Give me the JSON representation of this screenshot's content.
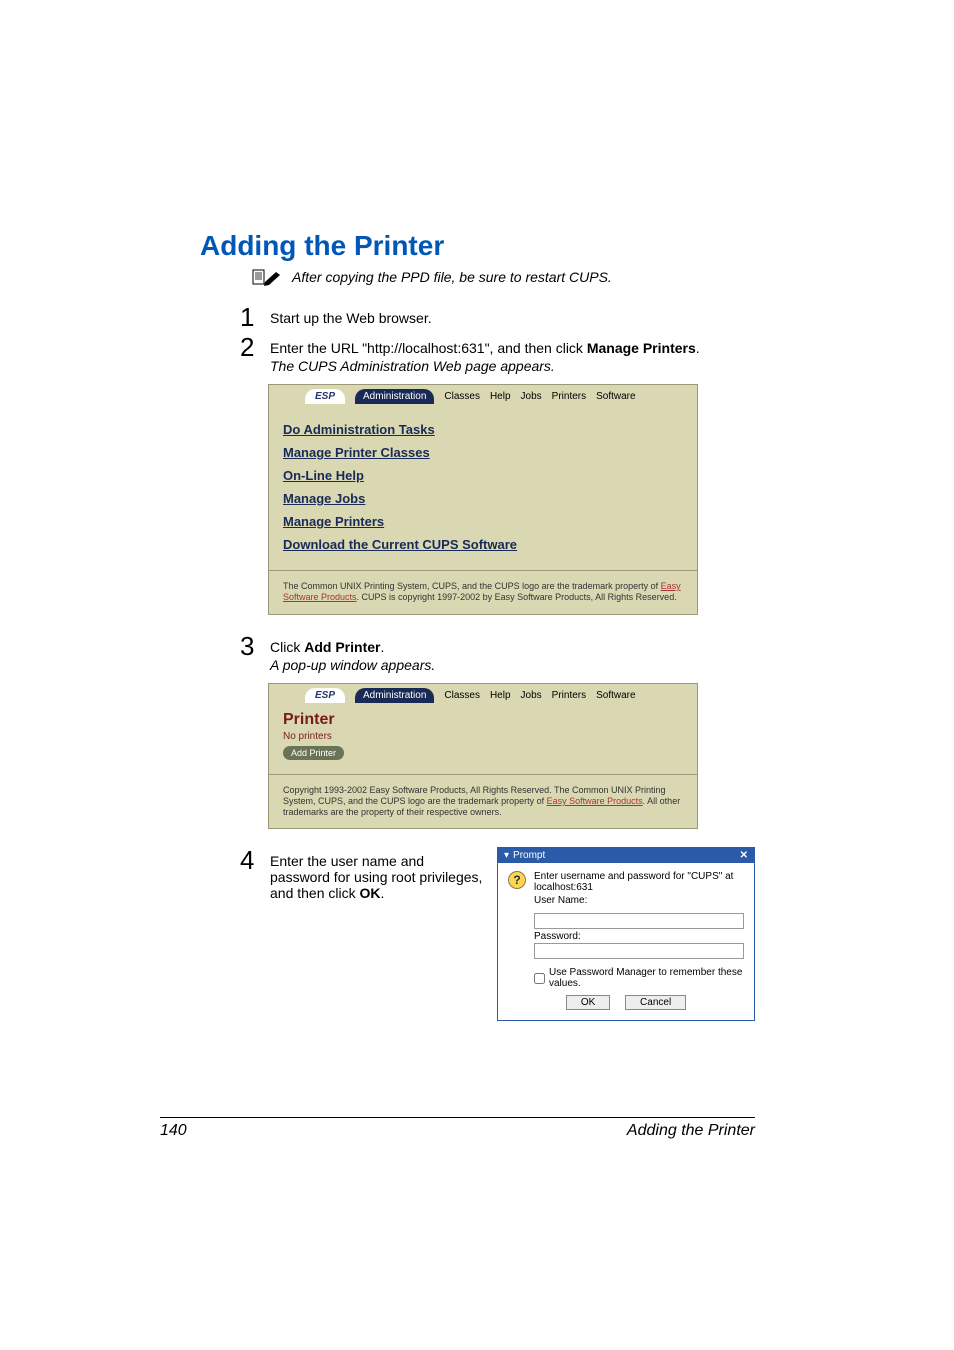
{
  "heading": "Adding the Printer",
  "note": {
    "text": "After copying the PPD file, be sure to restart CUPS."
  },
  "steps": {
    "s1": {
      "num": "1",
      "text": "Start up the Web browser."
    },
    "s2": {
      "num": "2",
      "text_a": "Enter the URL \"http://localhost:631\", and then click ",
      "text_bold": "Manage Printers",
      "text_b": ".",
      "sub": "The CUPS Administration Web page appears."
    },
    "s3": {
      "num": "3",
      "text_a": "Click ",
      "text_bold": "Add Printer",
      "text_b": ".",
      "sub": "A pop-up window appears."
    },
    "s4": {
      "num": "4",
      "text_a": "Enter the user name and password for using root privileges, and then click ",
      "text_bold": "OK",
      "text_b": "."
    }
  },
  "cups_tabs": {
    "esp": "ESP",
    "admin": "Administration",
    "classes": "Classes",
    "help": "Help",
    "jobs": "Jobs",
    "printers": "Printers",
    "software": "Software"
  },
  "cups1": {
    "links": {
      "l1": "Do Administration Tasks",
      "l2": "Manage Printer Classes",
      "l3": "On-Line Help",
      "l4": "Manage Jobs",
      "l5": "Manage Printers",
      "l6": "Download the Current CUPS Software"
    },
    "footnote_a": "The Common UNIX Printing System, CUPS, and the CUPS logo are the trademark property of ",
    "footnote_link": "Easy Software Products",
    "footnote_b": ". CUPS is copyright 1997-2002 by Easy Software Products, All Rights Reserved."
  },
  "cups2": {
    "printer": "Printer",
    "no_printers": "No printers",
    "add_printer": "Add Printer",
    "footnote_a": "Copyright 1993-2002 Easy Software Products, All Rights Reserved. The Common UNIX Printing System, CUPS, and the CUPS logo are the trademark property of ",
    "footnote_link": "Easy Software Products",
    "footnote_b": ". All other trademarks are the property of their respective owners."
  },
  "prompt": {
    "title": "Prompt",
    "close": "✕",
    "msg": "Enter username and password for \"CUPS\" at localhost:631",
    "user_label": "User Name:",
    "pass_label": "Password:",
    "remember": "Use Password Manager to remember these values.",
    "ok": "OK",
    "cancel": "Cancel",
    "user_value": "",
    "pass_value": ""
  },
  "footer": {
    "page": "140",
    "title": "Adding the Printer"
  }
}
